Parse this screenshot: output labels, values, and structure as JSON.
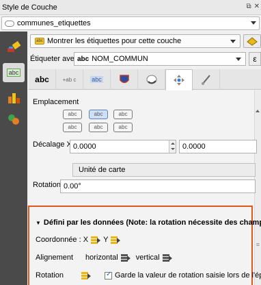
{
  "window": {
    "title": "Style de Couche",
    "float_icon": "float-icon",
    "close_icon": "close-icon"
  },
  "layer": {
    "name": "communes_etiquettes"
  },
  "label_mode": {
    "value": "Montrer les étiquettes pour cette couche"
  },
  "label_with": {
    "label": "Étiqueter avec",
    "prefix": "abc",
    "field": "NOM_COMMUN",
    "expr_button": "ε"
  },
  "tabs": [
    {
      "name": "text-tab",
      "label": "abc"
    },
    {
      "name": "formatting-tab",
      "label": "+ab c"
    },
    {
      "name": "buffer-tab",
      "label": "abc"
    },
    {
      "name": "background-tab",
      "label": ""
    },
    {
      "name": "shadow-tab",
      "label": ""
    },
    {
      "name": "placement-tab",
      "label": ""
    },
    {
      "name": "rendering-tab",
      "label": ""
    }
  ],
  "placement": {
    "section_label": "Emplacement",
    "button_text": "abc"
  },
  "offset": {
    "label": "Décalage X,Y",
    "x_value": "0.0000",
    "y_value": "0.0000",
    "unit": "Unité de carte"
  },
  "rotation": {
    "label": "Rotation",
    "value": "0.00°"
  },
  "data_defined": {
    "header": "Défini par les données (Note: la rotation nécessite des champs",
    "coordinate_label": "Coordonnée : X",
    "coordinate_y": "Y",
    "alignment_label": "Alignement",
    "horizontal": "horizontal",
    "vertical": "vertical",
    "rotation_label": "Rotation",
    "keep_rotation": "Garde la valeur de rotation saisie lors de l'épin"
  },
  "colors": {
    "highlight_border": "#e0561c",
    "dd_icon_yellow": "#e9b816",
    "left_strip": "#4a4a4a"
  }
}
